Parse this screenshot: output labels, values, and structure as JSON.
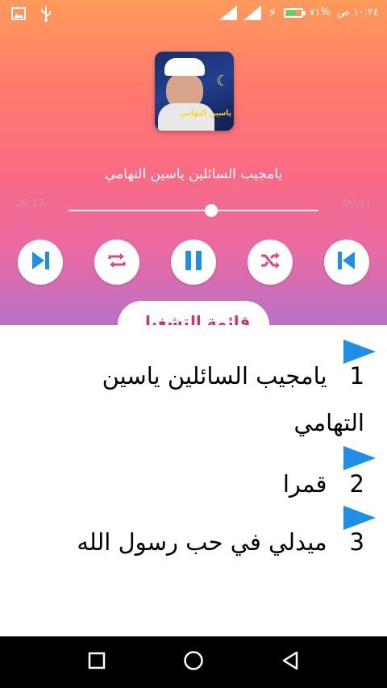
{
  "status_bar": {
    "time": "١٠:٢٤ ص",
    "battery_text": "٧١%",
    "icons": [
      "image-icon",
      "usb-icon",
      "signal-icon",
      "signal-icon",
      "charging-icon",
      "battery-icon"
    ]
  },
  "player": {
    "title": "يامجيب السائلين  ياسين التهامي",
    "elapsed": "28:17",
    "remaining": "00:01",
    "progress": 0.57,
    "controls": [
      "skip-next-icon",
      "repeat-icon",
      "pause-icon",
      "shuffle-icon",
      "skip-previous-icon"
    ],
    "cover_name": "ياسين التهامي"
  },
  "tab": {
    "label": "قائمة التشغيل"
  },
  "playlist": [
    {
      "number": "1",
      "title": "يامجيب السائلين  ياسين التهامي"
    },
    {
      "number": "2",
      "title": "قمرا"
    },
    {
      "number": "3",
      "title": "ميدلي في حب رسول الله"
    }
  ],
  "colors": {
    "accent": "#1f8fe6",
    "hero_top": "#ff9a5b",
    "hero_bottom": "#b872c6"
  }
}
